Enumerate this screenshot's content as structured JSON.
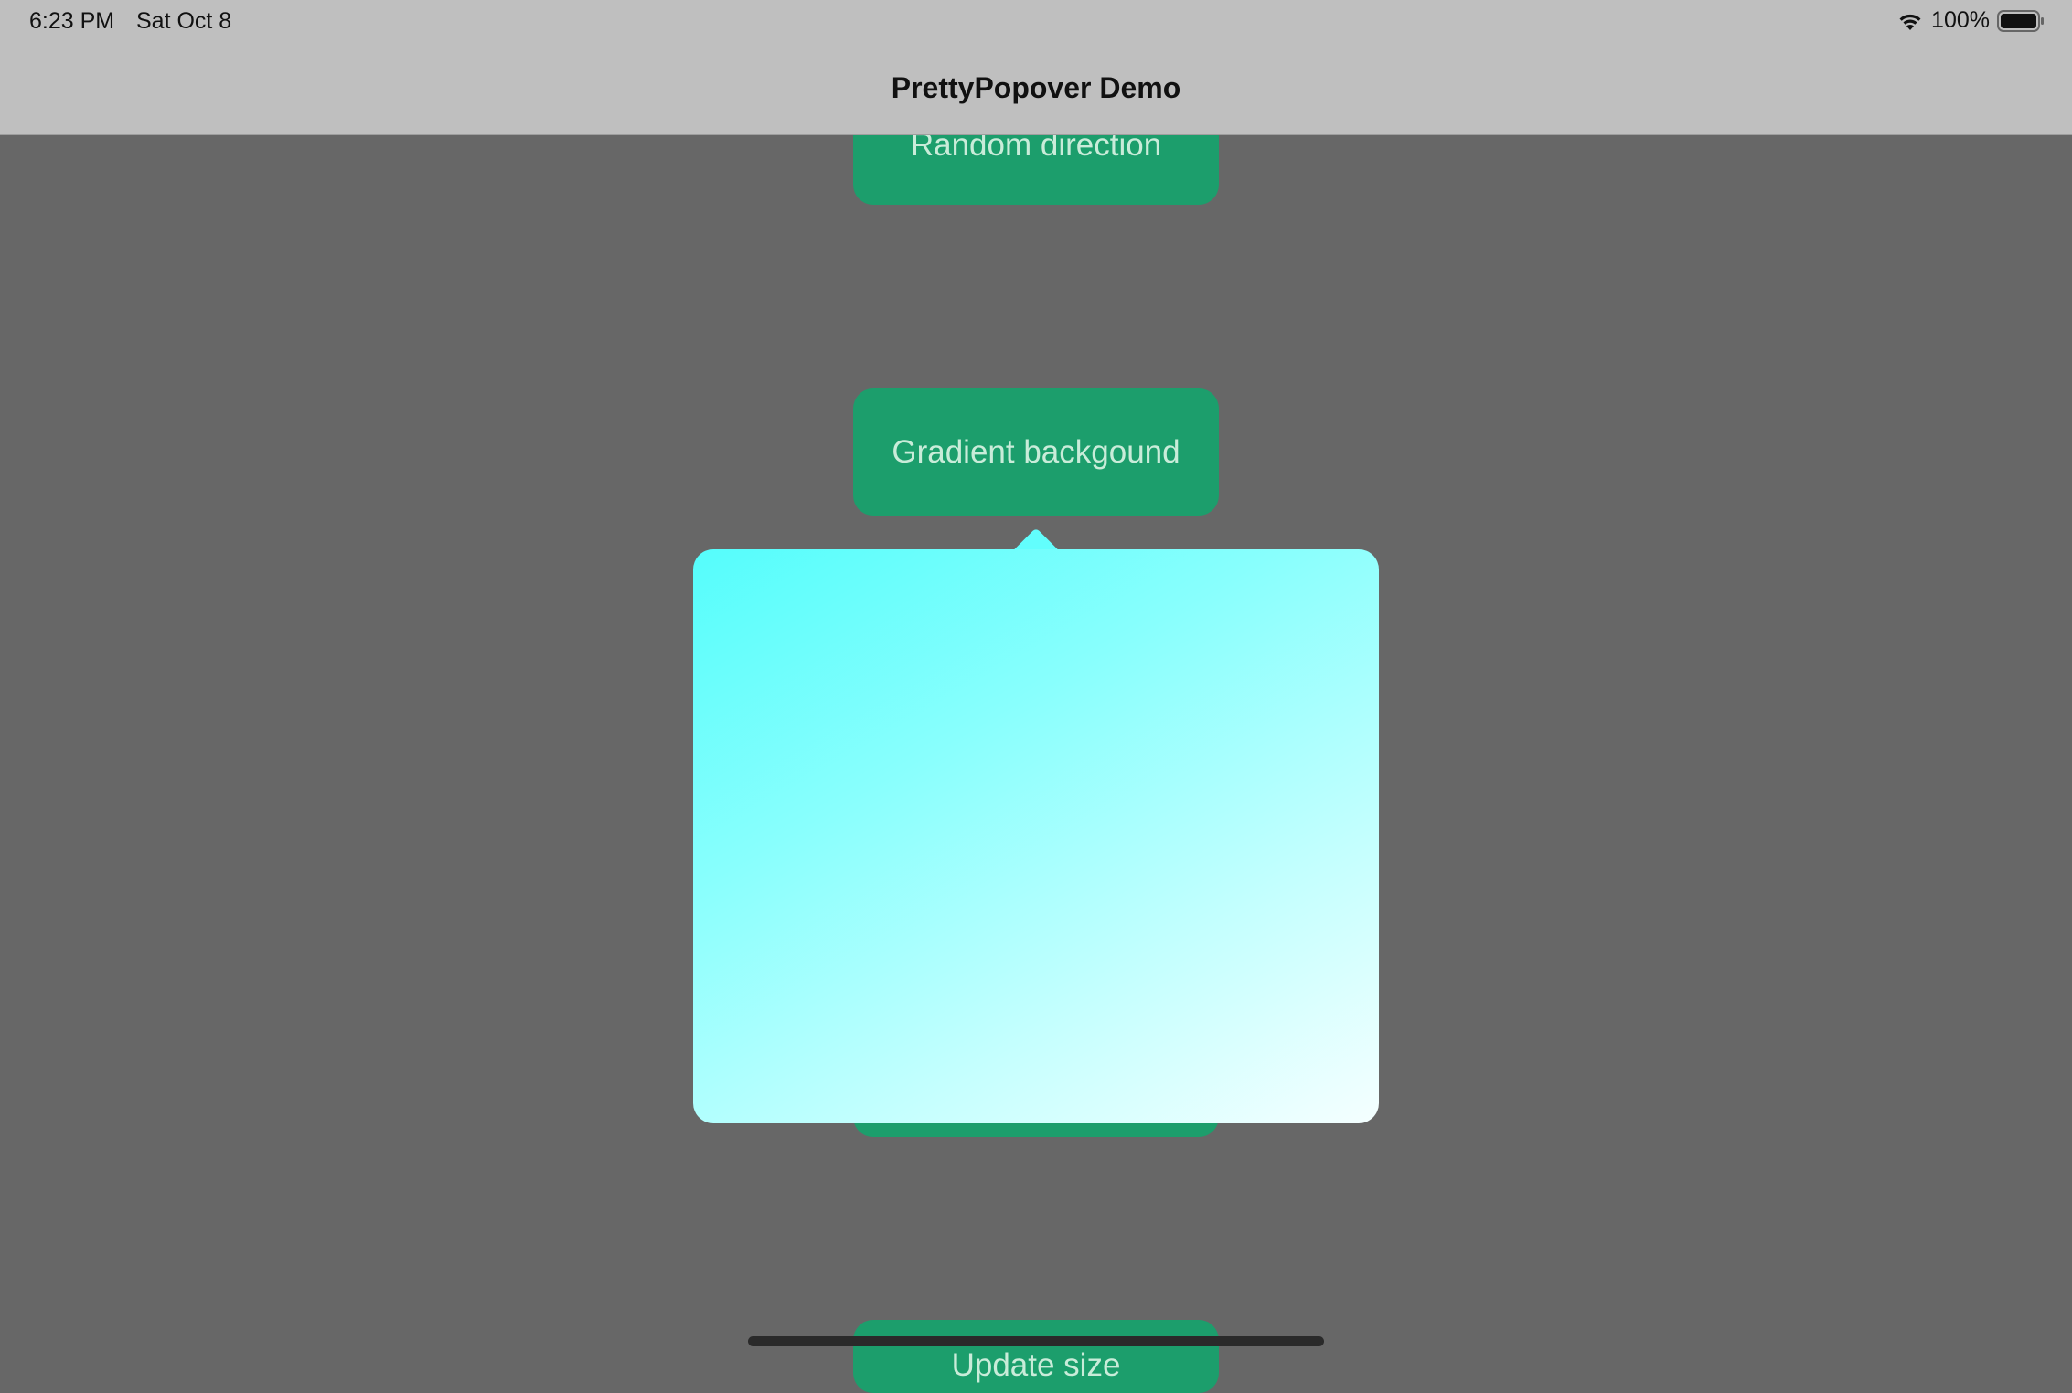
{
  "status_bar": {
    "time": "6:23 PM",
    "date": "Sat Oct 8",
    "battery": "100%",
    "icons": [
      "wifi-icon",
      "battery-icon"
    ]
  },
  "nav": {
    "title": "PrettyPopover Demo"
  },
  "buttons": {
    "random": "Random direction",
    "gradient": "Gradient backgound",
    "bottom": "Update size"
  },
  "colors": {
    "background": "#676767",
    "topbar": "#bfbfbf",
    "button": "#1c9e6c",
    "button_text": "#c9ecd9",
    "gradient_start": "#55fdfc",
    "gradient_end": "#f5ffff"
  }
}
